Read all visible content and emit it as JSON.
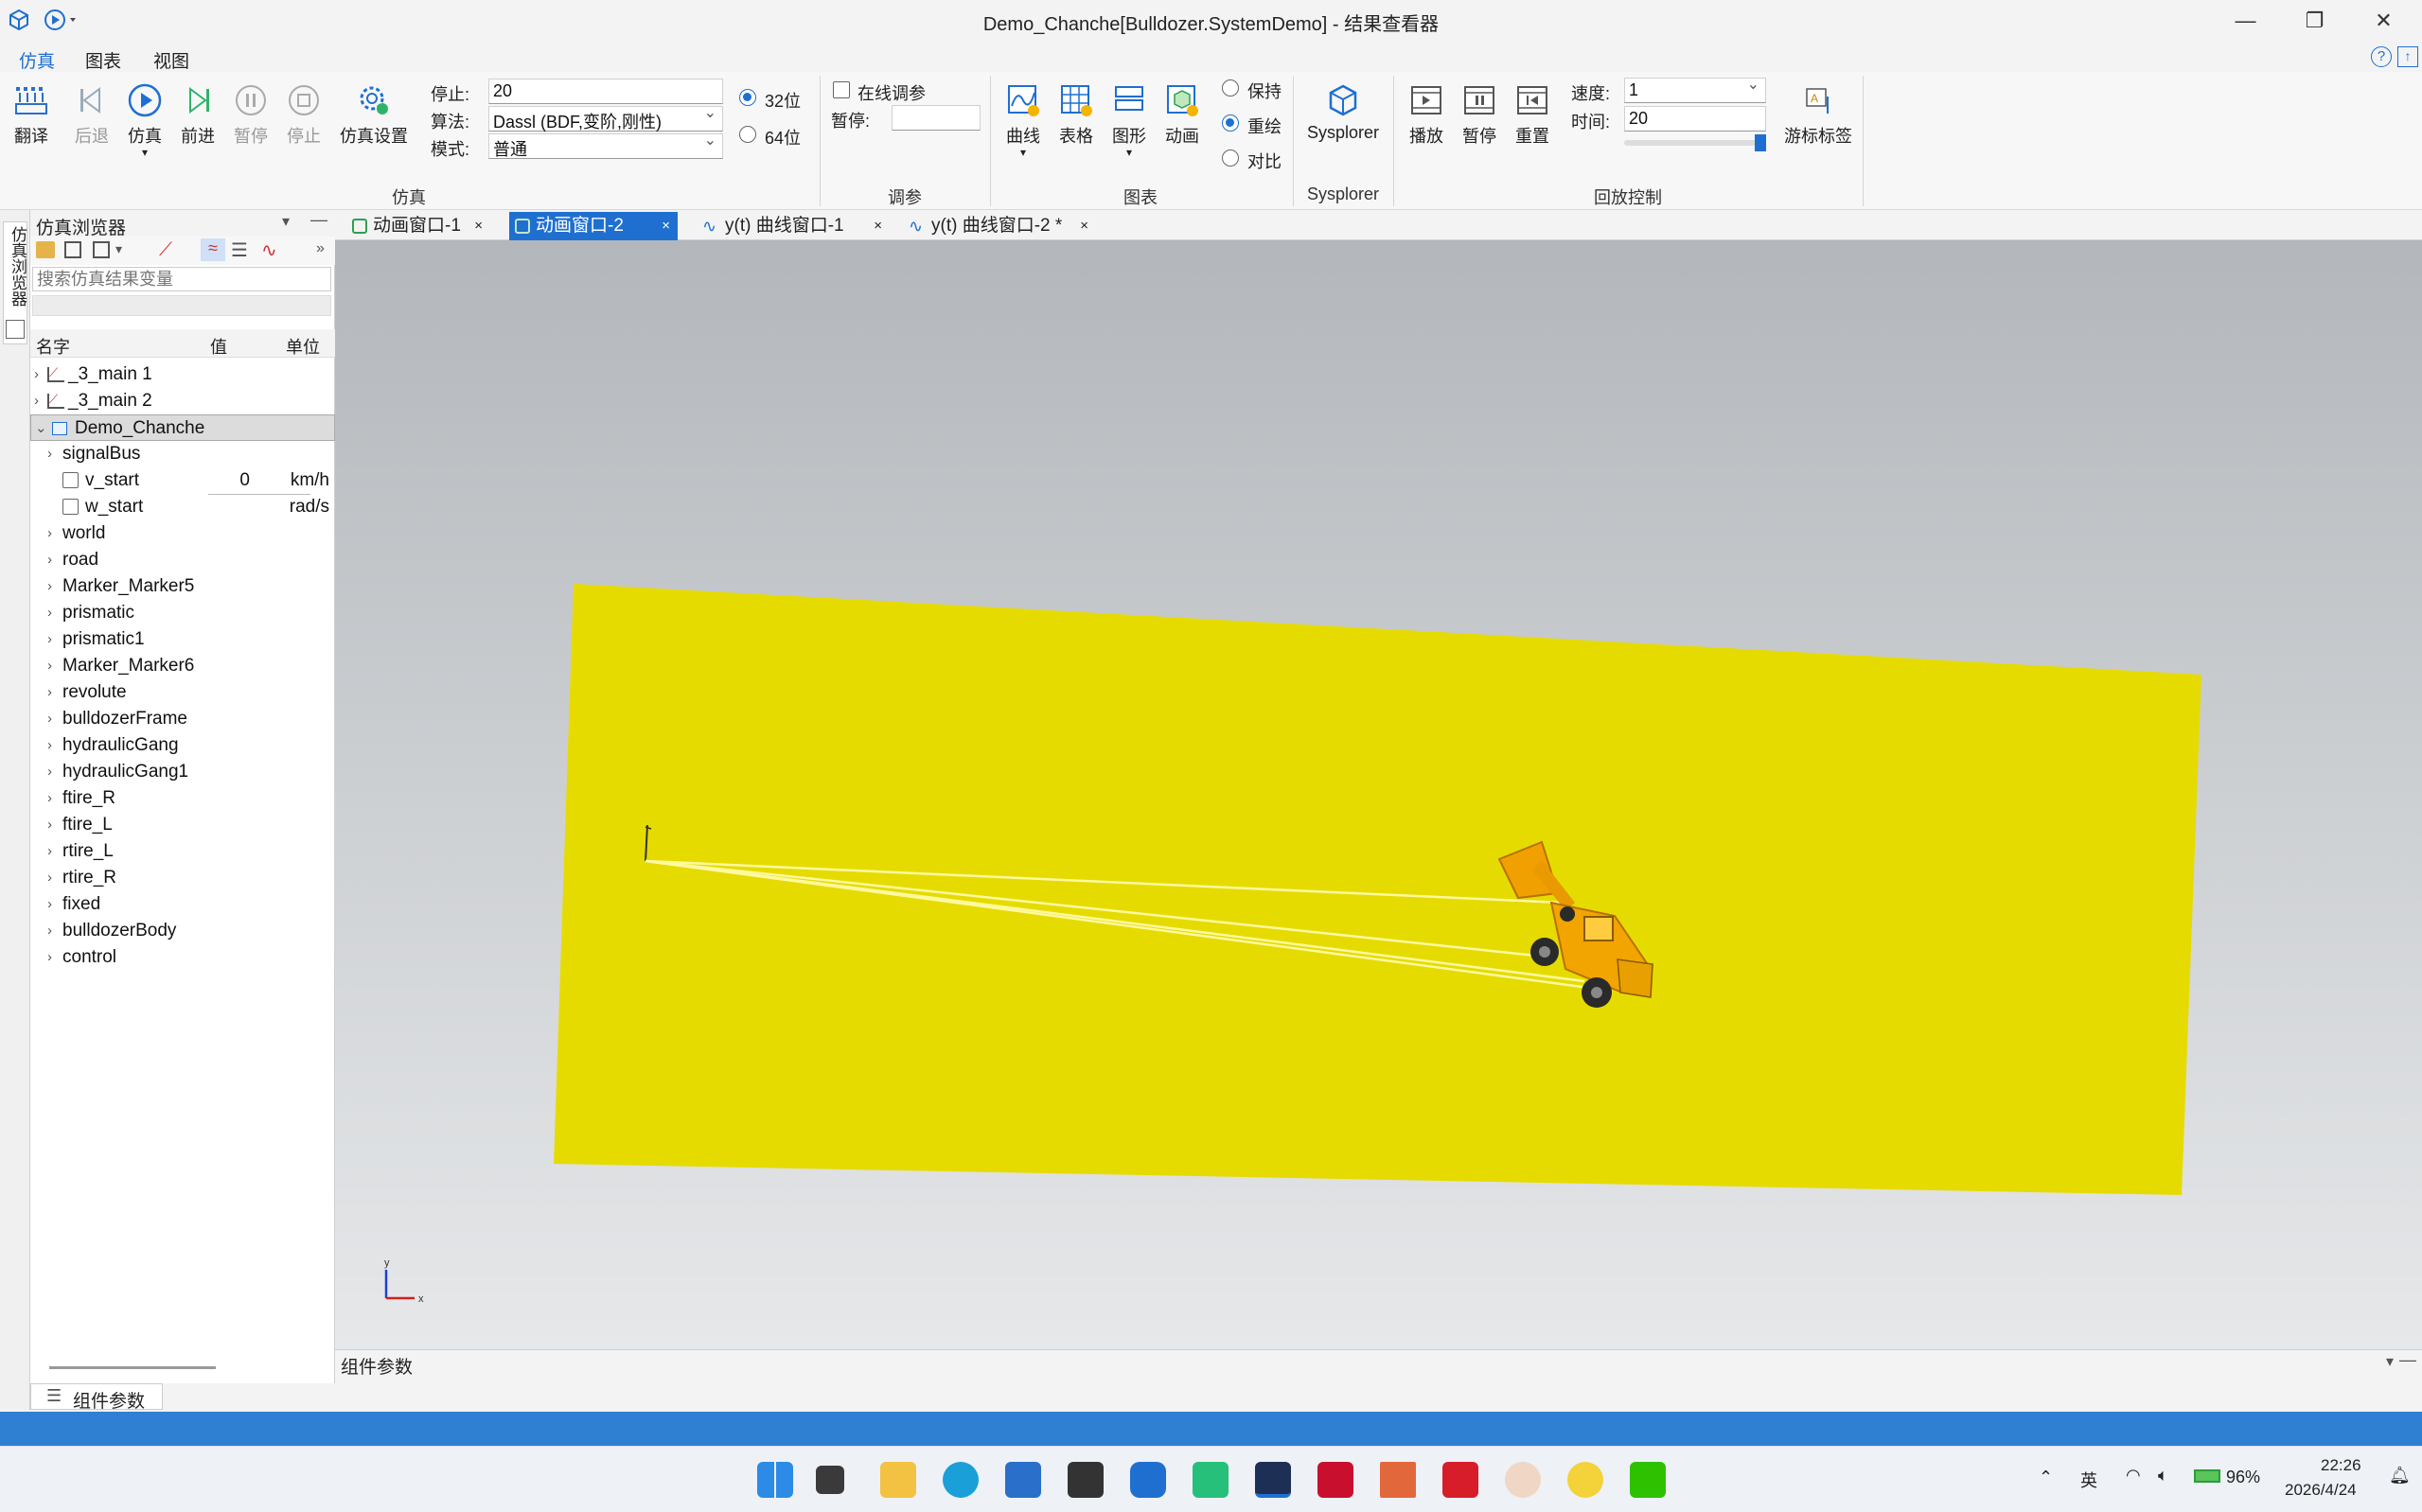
{
  "window": {
    "title": "Demo_Chanche[Bulldozer.SystemDemo] - 结果查看器"
  },
  "menus": [
    "仿真",
    "图表",
    "视图"
  ],
  "ribbon": {
    "buttons": {
      "translate": "翻译",
      "back": "后退",
      "simulate": "仿真",
      "forward": "前进",
      "pause": "暂停",
      "stop": "停止",
      "sim_settings": "仿真设置"
    },
    "stop_label": "停止:",
    "stop_value": "20",
    "algo_label": "算法:",
    "algo_value": "Dassl (BDF,变阶,刚性)",
    "mode_label": "模式:",
    "mode_value": "普通",
    "bit32": "32位",
    "bit64": "64位",
    "online_tune": "在线调参",
    "pause_label": "暂停:",
    "chart_buttons": {
      "curve": "曲线",
      "table": "表格",
      "graph": "图形",
      "anim": "动画"
    },
    "keep": "保持",
    "redraw": "重绘",
    "compare": "对比",
    "sysplorer": "Sysplorer",
    "playback": {
      "play": "播放",
      "pause": "暂停",
      "reset": "重置"
    },
    "speed_label": "速度:",
    "speed_value": "1",
    "time_label": "时间:",
    "time_value": "20",
    "cursor_label": "游标标签",
    "groups": {
      "sim": "仿真",
      "tune": "调参",
      "chart": "图表",
      "sysplorer": "Sysplorer",
      "playback": "回放控制"
    }
  },
  "browser": {
    "title": "仿真浏览器",
    "vtab": "仿真浏览器",
    "search_placeholder": "搜索仿真结果变量",
    "columns": [
      "名字",
      "值",
      "单位"
    ],
    "top_items": [
      "_3_main 1",
      "_3_main 2",
      "Demo_Chanche"
    ],
    "children": [
      {
        "name": "signalBus",
        "type": "group"
      },
      {
        "name": "v_start",
        "type": "var",
        "value": "0",
        "unit": "km/h"
      },
      {
        "name": "w_start",
        "type": "var",
        "value": "",
        "unit": "rad/s"
      },
      {
        "name": "world",
        "type": "group"
      },
      {
        "name": "road",
        "type": "group"
      },
      {
        "name": "Marker_Marker5",
        "type": "group"
      },
      {
        "name": "prismatic",
        "type": "group"
      },
      {
        "name": "prismatic1",
        "type": "group"
      },
      {
        "name": "Marker_Marker6",
        "type": "group"
      },
      {
        "name": "revolute",
        "type": "group"
      },
      {
        "name": "bulldozerFrame",
        "type": "group"
      },
      {
        "name": "hydraulicGang",
        "type": "group"
      },
      {
        "name": "hydraulicGang1",
        "type": "group"
      },
      {
        "name": "ftire_R",
        "type": "group"
      },
      {
        "name": "ftire_L",
        "type": "group"
      },
      {
        "name": "rtire_L",
        "type": "group"
      },
      {
        "name": "rtire_R",
        "type": "group"
      },
      {
        "name": "fixed",
        "type": "group"
      },
      {
        "name": "bulldozerBody",
        "type": "group"
      },
      {
        "name": "control",
        "type": "group"
      }
    ]
  },
  "doc_tabs": [
    "动画窗口-1",
    "动画窗口-2",
    "y(t) 曲线窗口-1",
    "y(t) 曲线窗口-2 *"
  ],
  "active_tab": 1,
  "component_params": "组件参数",
  "bottom_tab": "组件参数",
  "axis_labels": {
    "y": "y",
    "x": "x"
  },
  "colors": {
    "accent": "#1f6fd1",
    "ground": "#e6db00",
    "status": "#2f7fd3",
    "machine": "#e8a100"
  },
  "taskbar": {
    "ime": "英",
    "battery": "96%",
    "time": "22:26",
    "date": "2026/4/24"
  }
}
